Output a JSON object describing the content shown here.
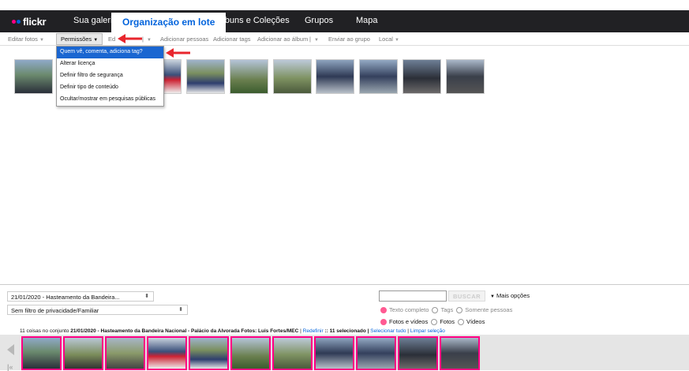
{
  "brand": {
    "name": "flickr"
  },
  "nav": {
    "tabs": [
      {
        "label": "Sua galeria"
      },
      {
        "label": "Organização em lote"
      },
      {
        "label": "Álbuns e Coleções"
      },
      {
        "label": "Grupos"
      },
      {
        "label": "Mapa"
      }
    ],
    "active": "Organização em lote"
  },
  "toolbar": {
    "edit_photos": "Editar fotos",
    "permissions": "Permissões",
    "edit_partial": "Ed",
    "add_people": "Adicionar pessoas",
    "add_tags": "Adicionar tags",
    "add_to_album": "Adicionar ao álbum",
    "send_to_group": "Enviar ao grupo",
    "local": "Local"
  },
  "permissions_menu": {
    "items": [
      "Quem vê, comenta, adiciona tag?",
      "Alterar licença",
      "Definir filtro de segurança",
      "Definir tipo de conteúdo",
      "Ocultar/mostrar em pesquisas públicas"
    ],
    "highlighted": 0
  },
  "workspace": {
    "photo_count": 11
  },
  "filters": {
    "set_select": "21/01/2020 - Hasteamento da Bandeira...",
    "privacy_select": "Sem filtro de privacidade/Familiar",
    "search_button": "BUSCAR",
    "more_options": "Mais opções",
    "search_scope": {
      "options": [
        "Texto completo",
        "Tags",
        "Somente pessoas"
      ],
      "selected": "Texto completo"
    },
    "media_type": {
      "options": [
        "Fotos e vídeos",
        "Fotos",
        "Vídeos"
      ],
      "selected": "Fotos e vídeos"
    }
  },
  "summary": {
    "count_text": "11 coisas no conjunto",
    "set_name": "21/01/2020 - Hasteamento da Bandeira Nacional - Palácio da Alvorada Fotos: Luis Fortes/MEC",
    "redefine": "Redefinir",
    "selected_text": ":: 11 selecionado |",
    "select_all": "Selecionar tudo",
    "sep": "|",
    "clear_selection": "Limpar seleção"
  },
  "filmstrip": {
    "thumb_count": 11,
    "prev_icon": "triangle-left-icon"
  },
  "colors": {
    "topbar": "#212124",
    "brand_pink": "#ff0084",
    "brand_blue": "#0063dc",
    "menu_highlight": "#1a66d1",
    "annotation_arrow": "#e8262d"
  }
}
